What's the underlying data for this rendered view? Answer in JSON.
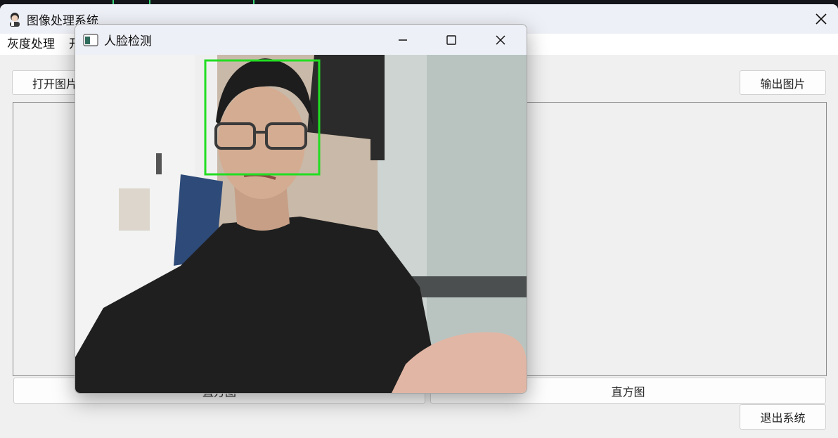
{
  "main_window": {
    "title": "图像处理系统",
    "icon": "avatar-icon",
    "menu": [
      "灰度处理",
      "开"
    ],
    "buttons": {
      "open_image": "打开图片",
      "output_image": "输出图片",
      "histogram_left": "直方图",
      "histogram_right": "直方图",
      "exit": "退出系统"
    }
  },
  "face_window": {
    "title": "人脸检测",
    "icon": "app-window-icon",
    "controls": [
      "minimize-icon",
      "maximize-icon",
      "close-icon"
    ],
    "detection_color": "#22dd22"
  },
  "colors": {
    "title_bar": "#eef0f7",
    "window_bg": "#f0f0f0",
    "panel_border": "#8c8c8c"
  }
}
